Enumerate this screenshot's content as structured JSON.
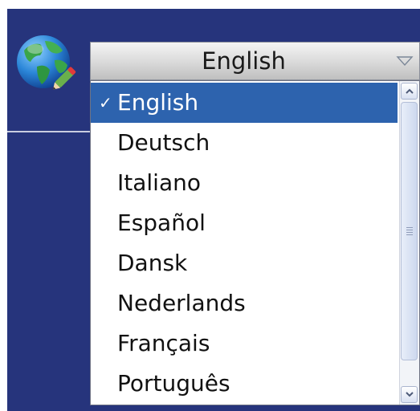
{
  "language_selector": {
    "selected_value": "English",
    "check_mark": "✓",
    "options": [
      {
        "label": "English",
        "selected": true
      },
      {
        "label": "Deutsch",
        "selected": false
      },
      {
        "label": "Italiano",
        "selected": false
      },
      {
        "label": "Español",
        "selected": false
      },
      {
        "label": "Dansk",
        "selected": false
      },
      {
        "label": "Nederlands",
        "selected": false
      },
      {
        "label": "Français",
        "selected": false
      },
      {
        "label": "Português",
        "selected": false
      }
    ]
  },
  "icons": {
    "language_icon": "globe-with-pencil-icon",
    "dropdown_arrow": "chevron-down-icon",
    "scroll_up": "scroll-up-icon",
    "scroll_down": "scroll-down-icon"
  },
  "colors": {
    "panel_background": "#26347c",
    "selected_background": "#2d63ae",
    "selected_text": "#ffffff",
    "option_text": "#111111"
  }
}
